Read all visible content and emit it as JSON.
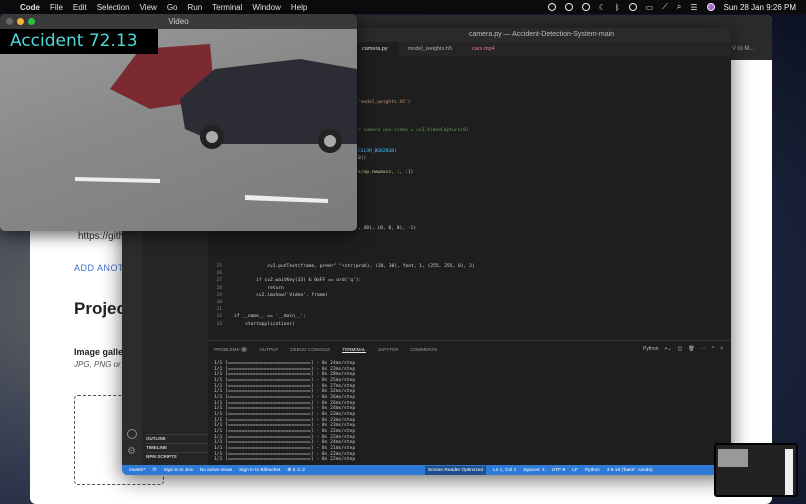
{
  "menubar": {
    "app": "Code",
    "items": [
      "File",
      "Edit",
      "Selection",
      "View",
      "Go",
      "Run",
      "Terminal",
      "Window",
      "Help"
    ],
    "clock": "Sun 28 Jan  9:26 PM"
  },
  "browser": {
    "url_fragment": "https://gith",
    "add_another": "ADD ANOTH",
    "heading": "Projec",
    "gallery_label": "Image galle",
    "gallery_hint": "JPG, PNG or G",
    "tab_fragment": "V to M..."
  },
  "vscode": {
    "title": "camera.py — Accident-Detection-System-main",
    "tabs": [
      "camera.py",
      "model_weights.h5",
      "cars.mp4"
    ],
    "code_fragments": [
      {
        "ln": "",
        "text": "'model_weights.h5')"
      },
      {
        "ln": "",
        "text": "r camera use video = cv2.VideoCapture(0)"
      },
      {
        "ln": "",
        "text": "COLOR_BGR2RGB)"
      },
      {
        "ln": "",
        "text": "0])"
      },
      {
        "ln": "",
        "text": "s(np.newaxis, :, :])"
      },
      {
        "ln": "",
        "text": ", 40), (0, 0, 0), -1)"
      }
    ],
    "code_lines": [
      {
        "ln": "25",
        "text": "            cv2.putText(frame, pred+\" \"+str(prob), (20, 30), font, 1, (255, 255, 0), 2)"
      },
      {
        "ln": "26",
        "text": ""
      },
      {
        "ln": "27",
        "text": "        if cv2.waitKey(33) & 0xFF == ord('q'):"
      },
      {
        "ln": "28",
        "text": "            return"
      },
      {
        "ln": "29",
        "text": "        cv2.imshow('Video', frame)"
      },
      {
        "ln": "30",
        "text": ""
      },
      {
        "ln": "31",
        "text": ""
      },
      {
        "ln": "32",
        "text": "if __name__ == '__main__':"
      },
      {
        "ln": "33",
        "text": "    startapplication()"
      }
    ],
    "sidebar_sections": [
      "OUTLINE",
      "TIMELINE",
      "NPM SCRIPTS"
    ],
    "panel_tabs": [
      "PROBLEMS",
      "OUTPUT",
      "DEBUG CONSOLE",
      "TERMINAL",
      "JUPYTER",
      "COMMENTS"
    ],
    "problems_count": "2",
    "terminal_profile": "Python",
    "terminal_times": [
      "24ms",
      "23ms",
      "28ms",
      "25ms",
      "27ms",
      "32ms",
      "26ms",
      "26ms",
      "24ms",
      "23ms",
      "23ms",
      "23ms",
      "22ms",
      "22ms",
      "24ms",
      "21ms",
      "22ms",
      "22ms"
    ],
    "status": {
      "branch": "master*",
      "jira": "Sign in to Jira",
      "issue": "No active issue",
      "bitbucket": "Sign in to Bitbucket",
      "problems": "⊗ 0 ⚠ 2",
      "sro": "Screen Reader Optimized",
      "pos": "Ln 1, Col 1",
      "spaces": "Spaces: 4",
      "enc": "UTF-8",
      "eol": "LF",
      "lang": "Python",
      "interp": "3.9.16 ('base': conda)"
    }
  },
  "video": {
    "title": "Video",
    "prediction": "Accident 72.13"
  },
  "colors": {
    "accent": "#2f7ad6",
    "label": "#4fd8d8"
  }
}
